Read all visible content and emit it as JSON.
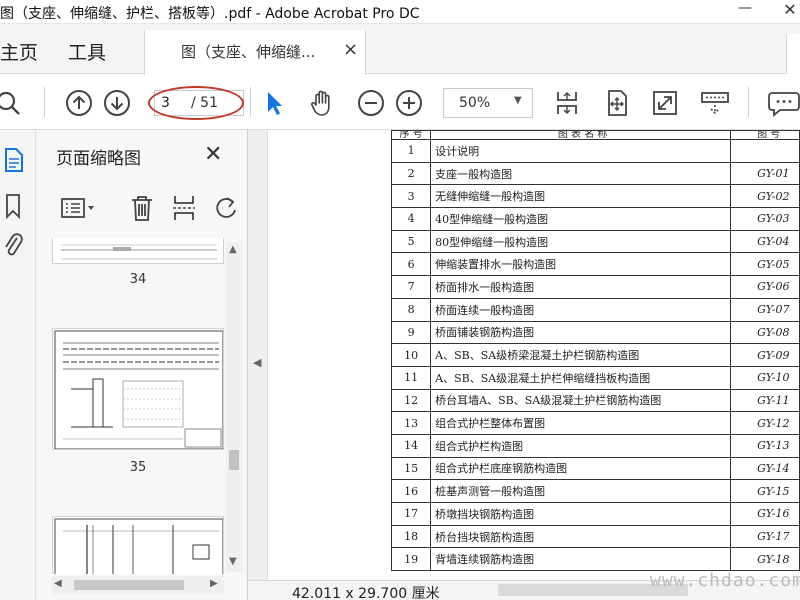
{
  "window": {
    "title": "图（支座、伸缩缝、护栏、搭板等）.pdf - Adobe Acrobat Pro DC",
    "min_glyph": "—",
    "close_glyph": "✕"
  },
  "menu": {
    "home": "主页",
    "tools": "工具"
  },
  "tab": {
    "label": "图（支座、伸缩缝...",
    "close": "×"
  },
  "toolbar": {
    "current_page": "3",
    "total_pages": "/ 51",
    "zoom": "50%",
    "icons": [
      "search-icon",
      "page-up-icon",
      "page-down-icon",
      "select-arrow-icon",
      "hand-icon",
      "zoom-out-icon",
      "zoom-in-icon",
      "fit-page-icon",
      "full-screen-icon",
      "expand-icon",
      "scroll-mode-icon",
      "comment-icon"
    ]
  },
  "sidebar": {
    "panel_title": "页面缩略图",
    "panel_close": "✕",
    "thumbnails": [
      {
        "label": "34"
      },
      {
        "label": "35"
      },
      {
        "label": ""
      }
    ]
  },
  "status": {
    "page_size": "42.011 x 29.700 厘米"
  },
  "document": {
    "header_num": "序 号",
    "header_name": "图 表 名 称",
    "header_code": "图 号",
    "rows": [
      {
        "n": "1",
        "name": "设计说明",
        "code": ""
      },
      {
        "n": "2",
        "name": "支座一般构造图",
        "code": "GY-01"
      },
      {
        "n": "3",
        "name": "无缝伸缩缝一般构造图",
        "code": "GY-02"
      },
      {
        "n": "4",
        "name": "40型伸缩缝一般构造图",
        "code": "GY-03"
      },
      {
        "n": "5",
        "name": "80型伸缩缝一般构造图",
        "code": "GY-04"
      },
      {
        "n": "6",
        "name": "伸缩装置排水一般构造图",
        "code": "GY-05"
      },
      {
        "n": "7",
        "name": "桥面排水一般构造图",
        "code": "GY-06"
      },
      {
        "n": "8",
        "name": "桥面连续一般构造图",
        "code": "GY-07"
      },
      {
        "n": "9",
        "name": "桥面铺装钢筋构造图",
        "code": "GY-08"
      },
      {
        "n": "10",
        "name": "A、SB、SA级桥梁混凝土护栏钢筋构造图",
        "code": "GY-09"
      },
      {
        "n": "11",
        "name": "A、SB、SA级混凝土护栏伸缩缝挡板构造图",
        "code": "GY-10"
      },
      {
        "n": "12",
        "name": "桥台耳墙A、SB、SA级混凝土护栏钢筋构造图",
        "code": "GY-11"
      },
      {
        "n": "13",
        "name": "组合式护栏整体布置图",
        "code": "GY-12"
      },
      {
        "n": "14",
        "name": "组合式护栏构造图",
        "code": "GY-13"
      },
      {
        "n": "15",
        "name": "组合式护栏底座钢筋构造图",
        "code": "GY-14"
      },
      {
        "n": "16",
        "name": "桩基声测管一般构造图",
        "code": "GY-15"
      },
      {
        "n": "17",
        "name": "桥墩挡块钢筋构造图",
        "code": "GY-16"
      },
      {
        "n": "18",
        "name": "桥台挡块钢筋构造图",
        "code": "GY-17"
      },
      {
        "n": "19",
        "name": "背墙连续钢筋构造图",
        "code": "GY-18"
      }
    ]
  },
  "watermark": "www.chdao.com",
  "colors": {
    "accent_blue": "#1473e6",
    "annotation_red": "#c0392b"
  }
}
